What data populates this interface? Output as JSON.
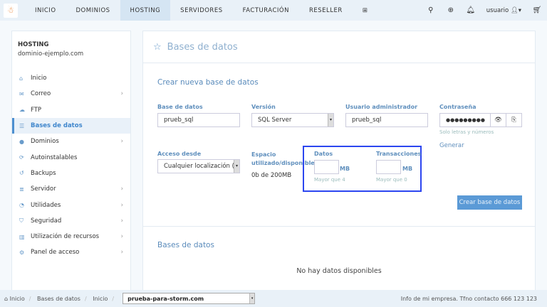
{
  "nav": {
    "items": [
      {
        "label": "INICIO"
      },
      {
        "label": "DOMINIOS"
      },
      {
        "label": "HOSTING",
        "active": true
      },
      {
        "label": "SERVIDORES"
      },
      {
        "label": "FACTURACIÓN"
      },
      {
        "label": "RESELLER"
      }
    ],
    "plus_icon": "plus-square-icon",
    "user": "usuario"
  },
  "sidebar": {
    "section": "HOSTING",
    "domain": "dominio-ejemplo.com",
    "items": [
      {
        "label": "Inicio",
        "icon": "home-icon"
      },
      {
        "label": "Correo",
        "icon": "envelope-icon",
        "sub": true
      },
      {
        "label": "FTP",
        "icon": "cloud-upload-icon"
      },
      {
        "label": "Bases de datos",
        "icon": "database-icon",
        "active": true
      },
      {
        "label": "Dominios",
        "icon": "globe-icon",
        "sub": true
      },
      {
        "label": "Autoinstalables",
        "icon": "refresh-icon"
      },
      {
        "label": "Backups",
        "icon": "history-icon"
      },
      {
        "label": "Servidor",
        "icon": "server-icon",
        "sub": true
      },
      {
        "label": "Utilidades",
        "icon": "dashboard-icon",
        "sub": true
      },
      {
        "label": "Seguridad",
        "icon": "shield-icon",
        "sub": true
      },
      {
        "label": "Utilización de recursos",
        "icon": "bar-chart-icon",
        "sub": true
      },
      {
        "label": "Panel de acceso",
        "icon": "cogs-icon",
        "sub": true
      }
    ]
  },
  "main": {
    "title": "Bases de datos",
    "create_title": "Crear nueva base de datos",
    "form": {
      "db_label": "Base de datos",
      "db_value": "prueb_sql",
      "version_label": "Versión",
      "version_value": "SQL Server",
      "admin_label": "Usuario administrador",
      "admin_value": "prueb_sql",
      "pass_label": "Contraseña",
      "pass_value": "●●●●●●●●●",
      "pass_hint": "Solo letras y números",
      "generate": "Generar",
      "access_label": "Acceso desde",
      "access_value": "Cualquier localización (p",
      "space_label": "Espacio utilizado/disponible",
      "space_value": "0b de 200MB",
      "data_label": "Datos",
      "data_value": "",
      "data_unit": "MB",
      "data_hint": "Mayor que 4",
      "trans_label": "Transacciones",
      "trans_value": "",
      "trans_unit": "MB",
      "trans_hint": "Mayor que 0",
      "submit": "Crear base de datos"
    },
    "list_title": "Bases de datos",
    "empty": "No hay datos disponibles"
  },
  "footer": {
    "breadcrumb": [
      "Inicio",
      "Bases de datos",
      "Inicio"
    ],
    "domain_select": "prueba-para-storm.com",
    "info": "Info de mi empresa. Tfno contacto 666 123 123"
  }
}
